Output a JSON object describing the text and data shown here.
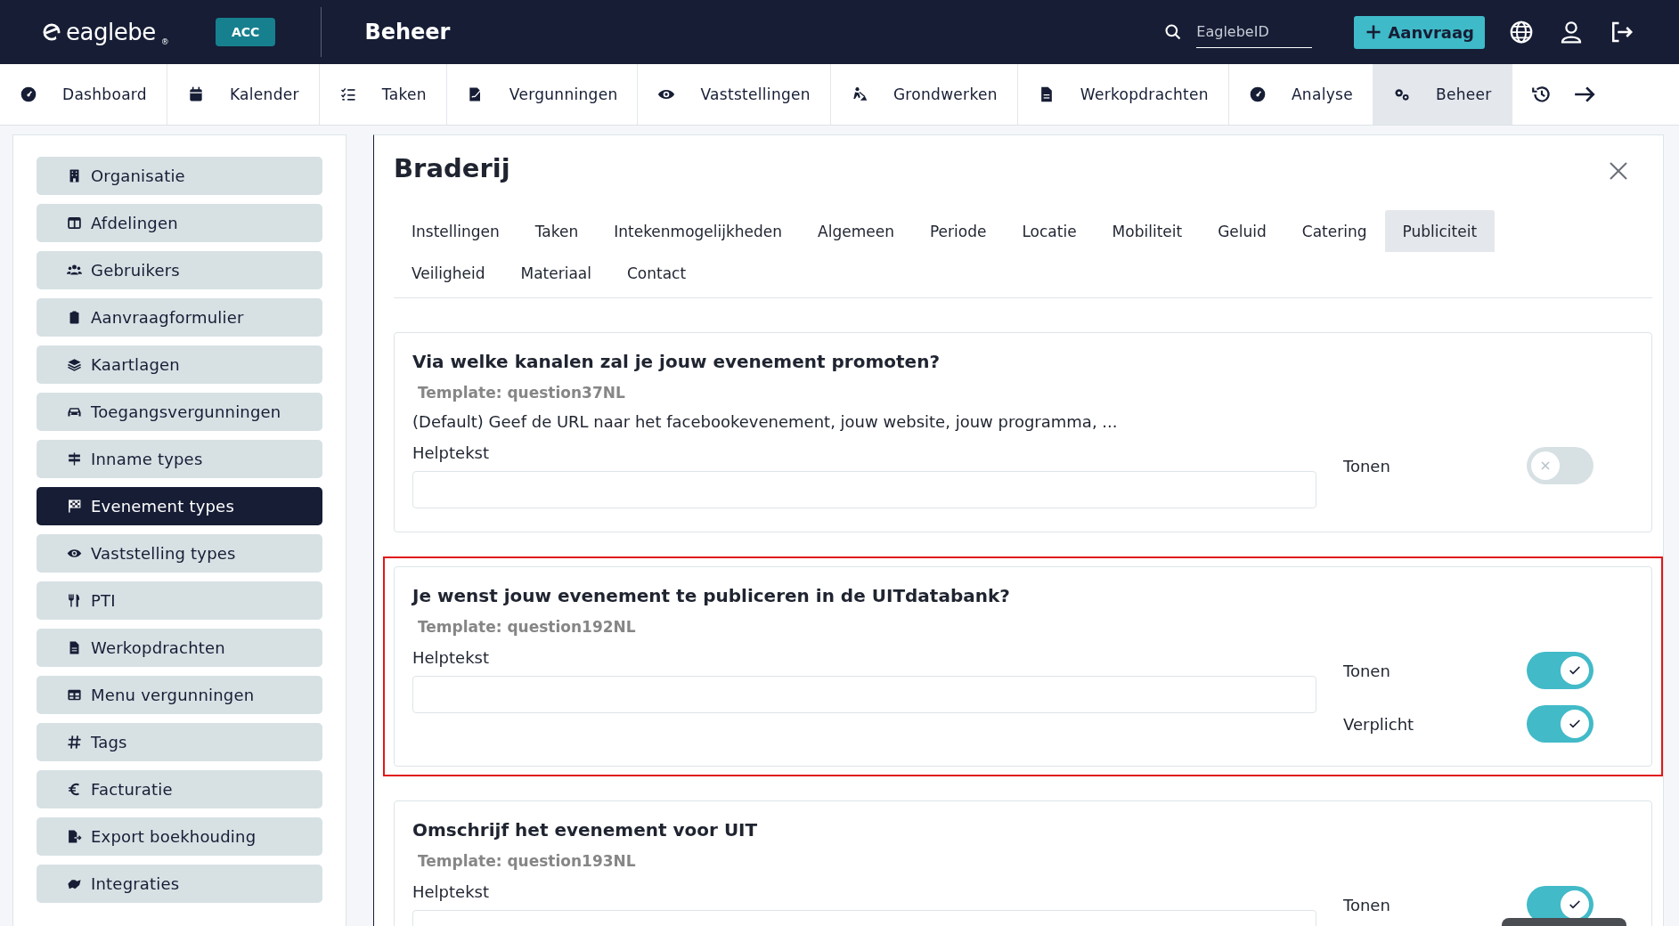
{
  "header": {
    "logo": "eaglebe",
    "logo_mark": "®",
    "environment": "ACC",
    "title": "Beheer",
    "search": {
      "placeholder": "EaglebeID"
    },
    "new_button": "Aanvraag"
  },
  "nav": [
    {
      "label": "Dashboard",
      "selected": false
    },
    {
      "label": "Kalender",
      "selected": false
    },
    {
      "label": "Taken",
      "selected": false
    },
    {
      "label": "Vergunningen",
      "selected": false
    },
    {
      "label": "Vaststellingen",
      "selected": false
    },
    {
      "label": "Grondwerken",
      "selected": false
    },
    {
      "label": "Werkopdrachten",
      "selected": false
    },
    {
      "label": "Analyse",
      "selected": false
    },
    {
      "label": "Beheer",
      "selected": true
    }
  ],
  "sidebar": {
    "items": [
      {
        "label": "Organisatie",
        "selected": false
      },
      {
        "label": "Afdelingen",
        "selected": false
      },
      {
        "label": "Gebruikers",
        "selected": false
      },
      {
        "label": "Aanvraagformulier",
        "selected": false
      },
      {
        "label": "Kaartlagen",
        "selected": false
      },
      {
        "label": "Toegangsvergunningen",
        "selected": false
      },
      {
        "label": "Inname types",
        "selected": false
      },
      {
        "label": "Evenement types",
        "selected": true
      },
      {
        "label": "Vaststelling types",
        "selected": false
      },
      {
        "label": "PTI",
        "selected": false
      },
      {
        "label": "Werkopdrachten",
        "selected": false
      },
      {
        "label": "Menu vergunningen",
        "selected": false
      },
      {
        "label": "Tags",
        "selected": false
      },
      {
        "label": "Facturatie",
        "selected": false
      },
      {
        "label": "Export boekhouding",
        "selected": false
      },
      {
        "label": "Integraties",
        "selected": false
      }
    ]
  },
  "detail": {
    "title": "Braderij",
    "tabs": [
      {
        "label": "Instellingen",
        "selected": false
      },
      {
        "label": "Taken",
        "selected": false
      },
      {
        "label": "Intekenmogelijkheden",
        "selected": false
      },
      {
        "label": "Algemeen",
        "selected": false
      },
      {
        "label": "Periode",
        "selected": false
      },
      {
        "label": "Locatie",
        "selected": false
      },
      {
        "label": "Mobiliteit",
        "selected": false
      },
      {
        "label": "Geluid",
        "selected": false
      },
      {
        "label": "Catering",
        "selected": false
      },
      {
        "label": "Publiciteit",
        "selected": true
      },
      {
        "label": "Veiligheid",
        "selected": false
      },
      {
        "label": "Materiaal",
        "selected": false
      },
      {
        "label": "Contact",
        "selected": false
      }
    ],
    "questions": [
      {
        "title": "Via welke kanalen zal je jouw evenement promoten?",
        "template": "Template: question37NL",
        "default_prefix": "(Default)",
        "default_text": "Geef de URL naar het facebookevenement, jouw website, jouw programma, ...",
        "helptext_label": "Helptekst",
        "highlighted": false,
        "toggles": [
          {
            "label": "Tonen",
            "on": false
          }
        ]
      },
      {
        "title": "Je wenst jouw evenement te publiceren in de UITdatabank?",
        "template": "Template: question192NL",
        "helptext_label": "Helptekst",
        "highlighted": true,
        "toggles": [
          {
            "label": "Tonen",
            "on": true
          },
          {
            "label": "Verplicht",
            "on": true
          }
        ]
      },
      {
        "title": "Omschrijf het evenement voor UIT",
        "template": "Template: question193NL",
        "helptext_label": "Helptekst",
        "highlighted": false,
        "toggles": [
          {
            "label": "Tonen",
            "on": true
          }
        ]
      }
    ]
  }
}
